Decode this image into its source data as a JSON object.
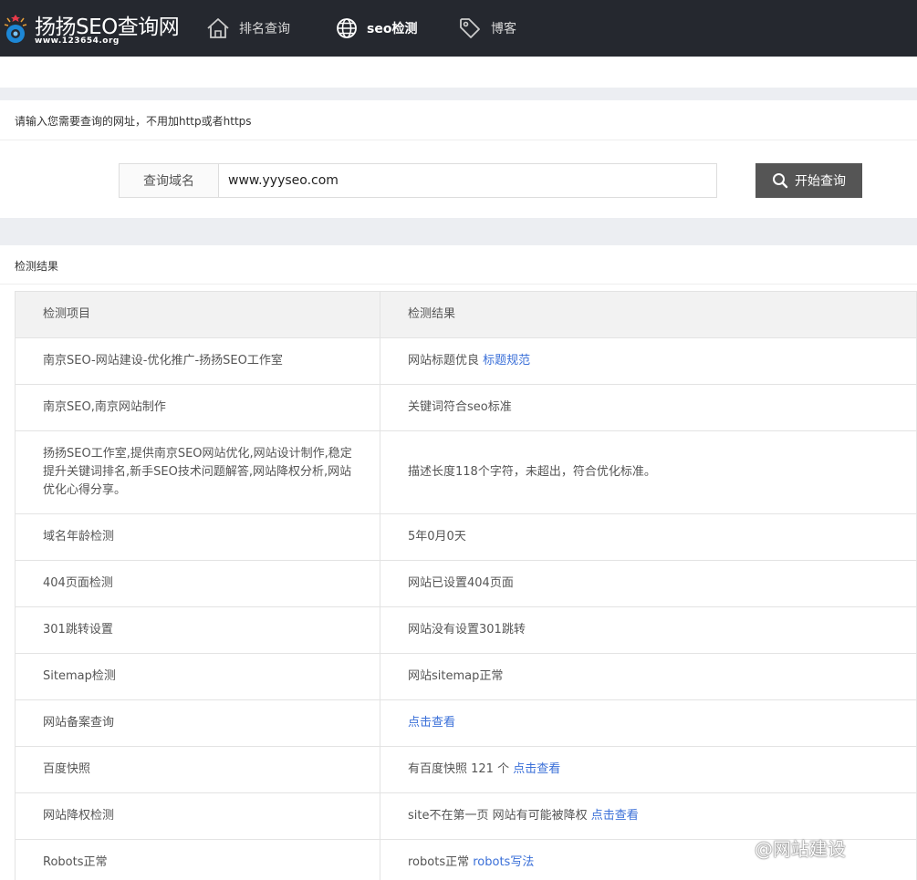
{
  "logo": {
    "title": "扬扬SEO查询网",
    "subtitle": "www.123654.org"
  },
  "nav": [
    {
      "label": "排名查询",
      "icon": "home-icon"
    },
    {
      "label": "seo检测",
      "icon": "globe-icon",
      "active": true
    },
    {
      "label": "博客",
      "icon": "tag-icon"
    }
  ],
  "query": {
    "instruction": "请输入您需要查询的网址，不用加http或者https",
    "label": "查询域名",
    "value": "www.yyyseo.com",
    "button": "开始查询"
  },
  "results": {
    "heading": "检测结果",
    "columns": [
      "检测项目",
      "检测结果"
    ],
    "rows": [
      {
        "item": "南京SEO-网站建设-优化推广-扬扬SEO工作室",
        "result": "网站标题优良 ",
        "link": "标题规范"
      },
      {
        "item": "南京SEO,南京网站制作",
        "result": "关键词符合seo标准",
        "link": ""
      },
      {
        "item": "扬扬SEO工作室,提供南京SEO网站优化,网站设计制作,稳定提升关键词排名,新手SEO技术问题解答,网站降权分析,网站优化心得分享。",
        "result": "描述长度118个字符，未超出，符合优化标准。",
        "link": ""
      },
      {
        "item": "域名年龄检测",
        "result": "5年0月0天",
        "link": ""
      },
      {
        "item": "404页面检测",
        "result": "网站已设置404页面",
        "link": ""
      },
      {
        "item": "301跳转设置",
        "result": "网站没有设置301跳转",
        "link": ""
      },
      {
        "item": "Sitemap检测",
        "result": "网站sitemap正常",
        "link": ""
      },
      {
        "item": "网站备案查询",
        "result": "",
        "link": "点击查看"
      },
      {
        "item": "百度快照",
        "result": "有百度快照 121 个 ",
        "link": "点击查看"
      },
      {
        "item": "网站降权检测",
        "result": "site不在第一页 网站有可能被降权 ",
        "link": "点击查看"
      },
      {
        "item": "Robots正常",
        "result": "robots正常 ",
        "link": "robots写法"
      }
    ]
  },
  "watermark": "@网站建设",
  "colors": {
    "topbar": "#25282f",
    "link": "#3a6fd8",
    "button": "#555555",
    "band": "#eceef2"
  }
}
